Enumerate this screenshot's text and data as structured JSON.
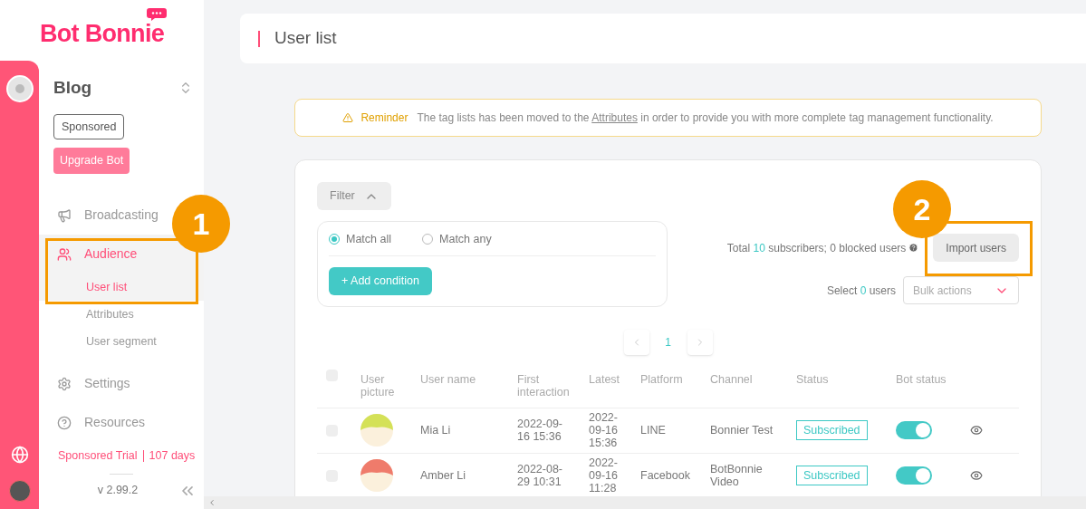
{
  "logo": {
    "text": "Bot Bonnie"
  },
  "bot": {
    "name": "Blog",
    "plan": "Sponsored",
    "upgrade": "Upgrade Bot"
  },
  "nav": [
    {
      "label": "Broadcasting",
      "kind": "megaphone",
      "selected": false
    },
    {
      "label": "Audience",
      "kind": "users",
      "selected": true,
      "children": [
        {
          "label": "User list",
          "selected": true
        },
        {
          "label": "Attributes",
          "selected": false
        },
        {
          "label": "User segment",
          "selected": false
        }
      ]
    },
    {
      "label": "Settings",
      "kind": "gear",
      "selected": false
    },
    {
      "label": "Resources",
      "kind": "help",
      "selected": false
    }
  ],
  "trial": {
    "label": "Sponsored Trial",
    "days": "107 days"
  },
  "version": "v 2.99.2",
  "page_title": "User list",
  "reminder": {
    "label": "Reminder",
    "before": "The tag lists has been moved to the",
    "link": "Attributes",
    "after": "in order to provide you with more complete tag management functionality."
  },
  "filter": {
    "label": "Filter",
    "expanded": true,
    "match": [
      {
        "label": "Match all",
        "selected": true
      },
      {
        "label": "Match any",
        "selected": false
      }
    ],
    "add": "+ Add condition"
  },
  "summary": {
    "before": "Total",
    "count": "10",
    "after": "subscribers; 0 blocked users"
  },
  "import": "Import users",
  "select": {
    "before": "Select",
    "count": "0",
    "after": "users"
  },
  "bulk": {
    "placeholder": "Bulk actions"
  },
  "pages": [
    {
      "label": "1",
      "selected": true
    }
  ],
  "select_all": {
    "checked": false
  },
  "columns": [
    "User picture",
    "User name",
    "First interaction",
    "Latest",
    "Platform",
    "Channel",
    "Status",
    "Bot status"
  ],
  "rows": [
    {
      "checked": false,
      "color": "#d4e157",
      "name": "Mia Li",
      "first": "2022-09-\n16 15:36",
      "latest": "2022-\n09-16\n15:36",
      "platform": "LINE",
      "channel": "Bonnier Test",
      "status": "Subscribed",
      "bot_on": true
    },
    {
      "checked": false,
      "color": "#ef7b6b",
      "name": "Amber Li",
      "first": "2022-08-\n29 10:31",
      "latest": "2022-\n09-16\n11:28",
      "platform": "Facebook",
      "channel": "BotBonnie\nVideo",
      "status": "Subscribed",
      "bot_on": true
    }
  ],
  "annotations": [
    {
      "label": "1"
    },
    {
      "label": "2"
    }
  ]
}
